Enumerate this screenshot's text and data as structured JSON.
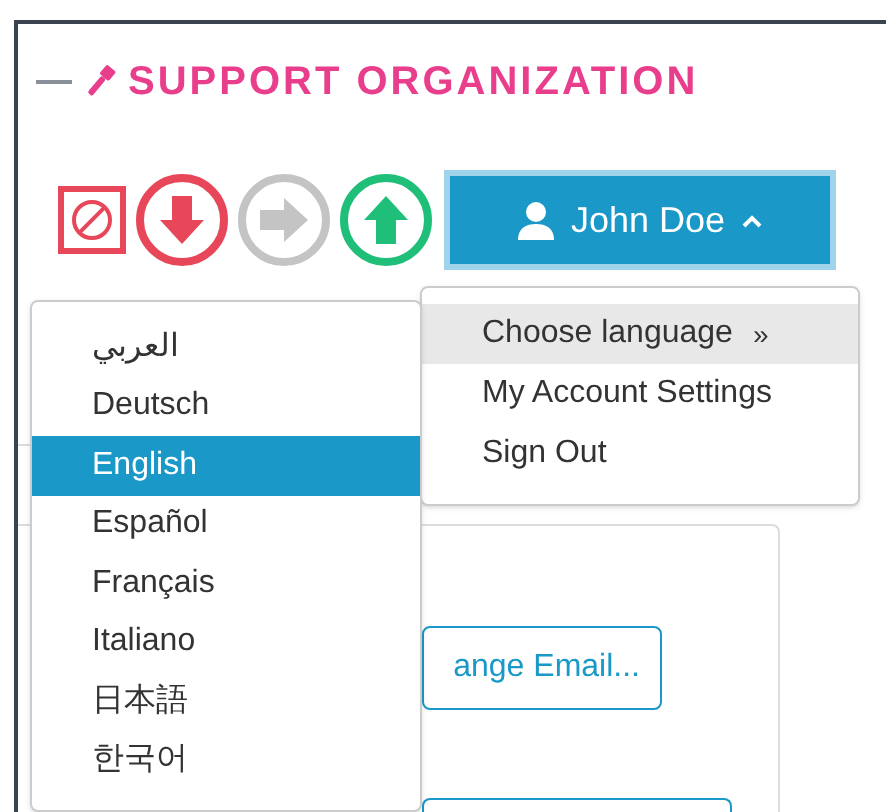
{
  "header": {
    "title": "SUPPORT ORGANIZATION"
  },
  "toolbar": {
    "actions": [
      {
        "kind": "ban"
      },
      {
        "kind": "down"
      },
      {
        "kind": "right"
      },
      {
        "kind": "up"
      }
    ],
    "user_button": {
      "label": "John Doe",
      "expanded": true
    }
  },
  "account_menu": {
    "items": [
      {
        "label": "Choose language",
        "submenu_mark": "»",
        "selected": true
      },
      {
        "label": "My Account Settings",
        "selected": false
      },
      {
        "label": "Sign Out",
        "selected": false
      }
    ]
  },
  "language_menu": {
    "items": [
      {
        "label": "العربي",
        "selected": false
      },
      {
        "label": "Deutsch",
        "selected": false
      },
      {
        "label": "English",
        "selected": true
      },
      {
        "label": "Español",
        "selected": false
      },
      {
        "label": "Français",
        "selected": false
      },
      {
        "label": "Italiano",
        "selected": false
      },
      {
        "label": "日本語",
        "selected": false
      },
      {
        "label": "한국어",
        "selected": false
      }
    ]
  },
  "card": {
    "buttons": [
      "ange Email..."
    ]
  }
}
